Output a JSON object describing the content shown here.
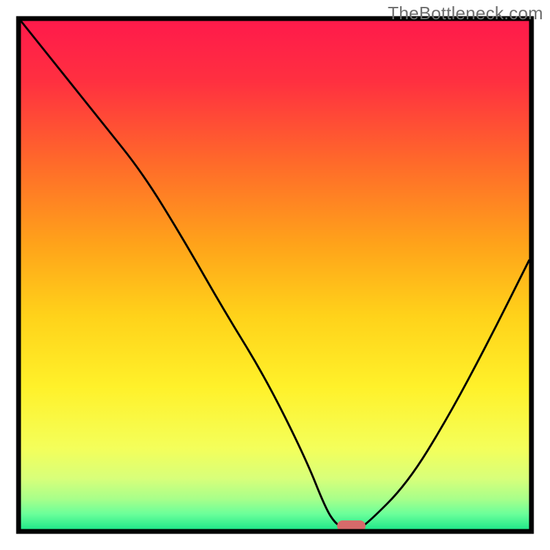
{
  "watermark": "TheBottleneck.com",
  "chart_data": {
    "type": "line",
    "title": "",
    "xlabel": "",
    "ylabel": "",
    "xlim": [
      0,
      100
    ],
    "ylim": [
      0,
      100
    ],
    "x": [
      0,
      8,
      16,
      24,
      32,
      40,
      48,
      56,
      60,
      62,
      64,
      66,
      68,
      76,
      84,
      92,
      100
    ],
    "values": [
      100,
      90,
      80,
      70,
      57,
      43,
      30,
      14,
      4,
      1,
      0,
      0,
      1,
      9,
      22,
      37,
      53
    ],
    "marker": {
      "x": 65,
      "width": 3.5,
      "color": "#d76a6a"
    },
    "gradient_stops": [
      {
        "offset": 0.0,
        "color": "#ff1a4b"
      },
      {
        "offset": 0.12,
        "color": "#ff3040"
      },
      {
        "offset": 0.28,
        "color": "#ff6a2a"
      },
      {
        "offset": 0.44,
        "color": "#ffa31a"
      },
      {
        "offset": 0.58,
        "color": "#ffd21a"
      },
      {
        "offset": 0.72,
        "color": "#fff12a"
      },
      {
        "offset": 0.84,
        "color": "#f4ff5a"
      },
      {
        "offset": 0.9,
        "color": "#d8ff7a"
      },
      {
        "offset": 0.94,
        "color": "#a8ff8a"
      },
      {
        "offset": 0.97,
        "color": "#6aff9a"
      },
      {
        "offset": 1.0,
        "color": "#20e88a"
      }
    ],
    "frame_color": "#000000",
    "line_color": "#000000",
    "background_outside": "#ffffff"
  }
}
